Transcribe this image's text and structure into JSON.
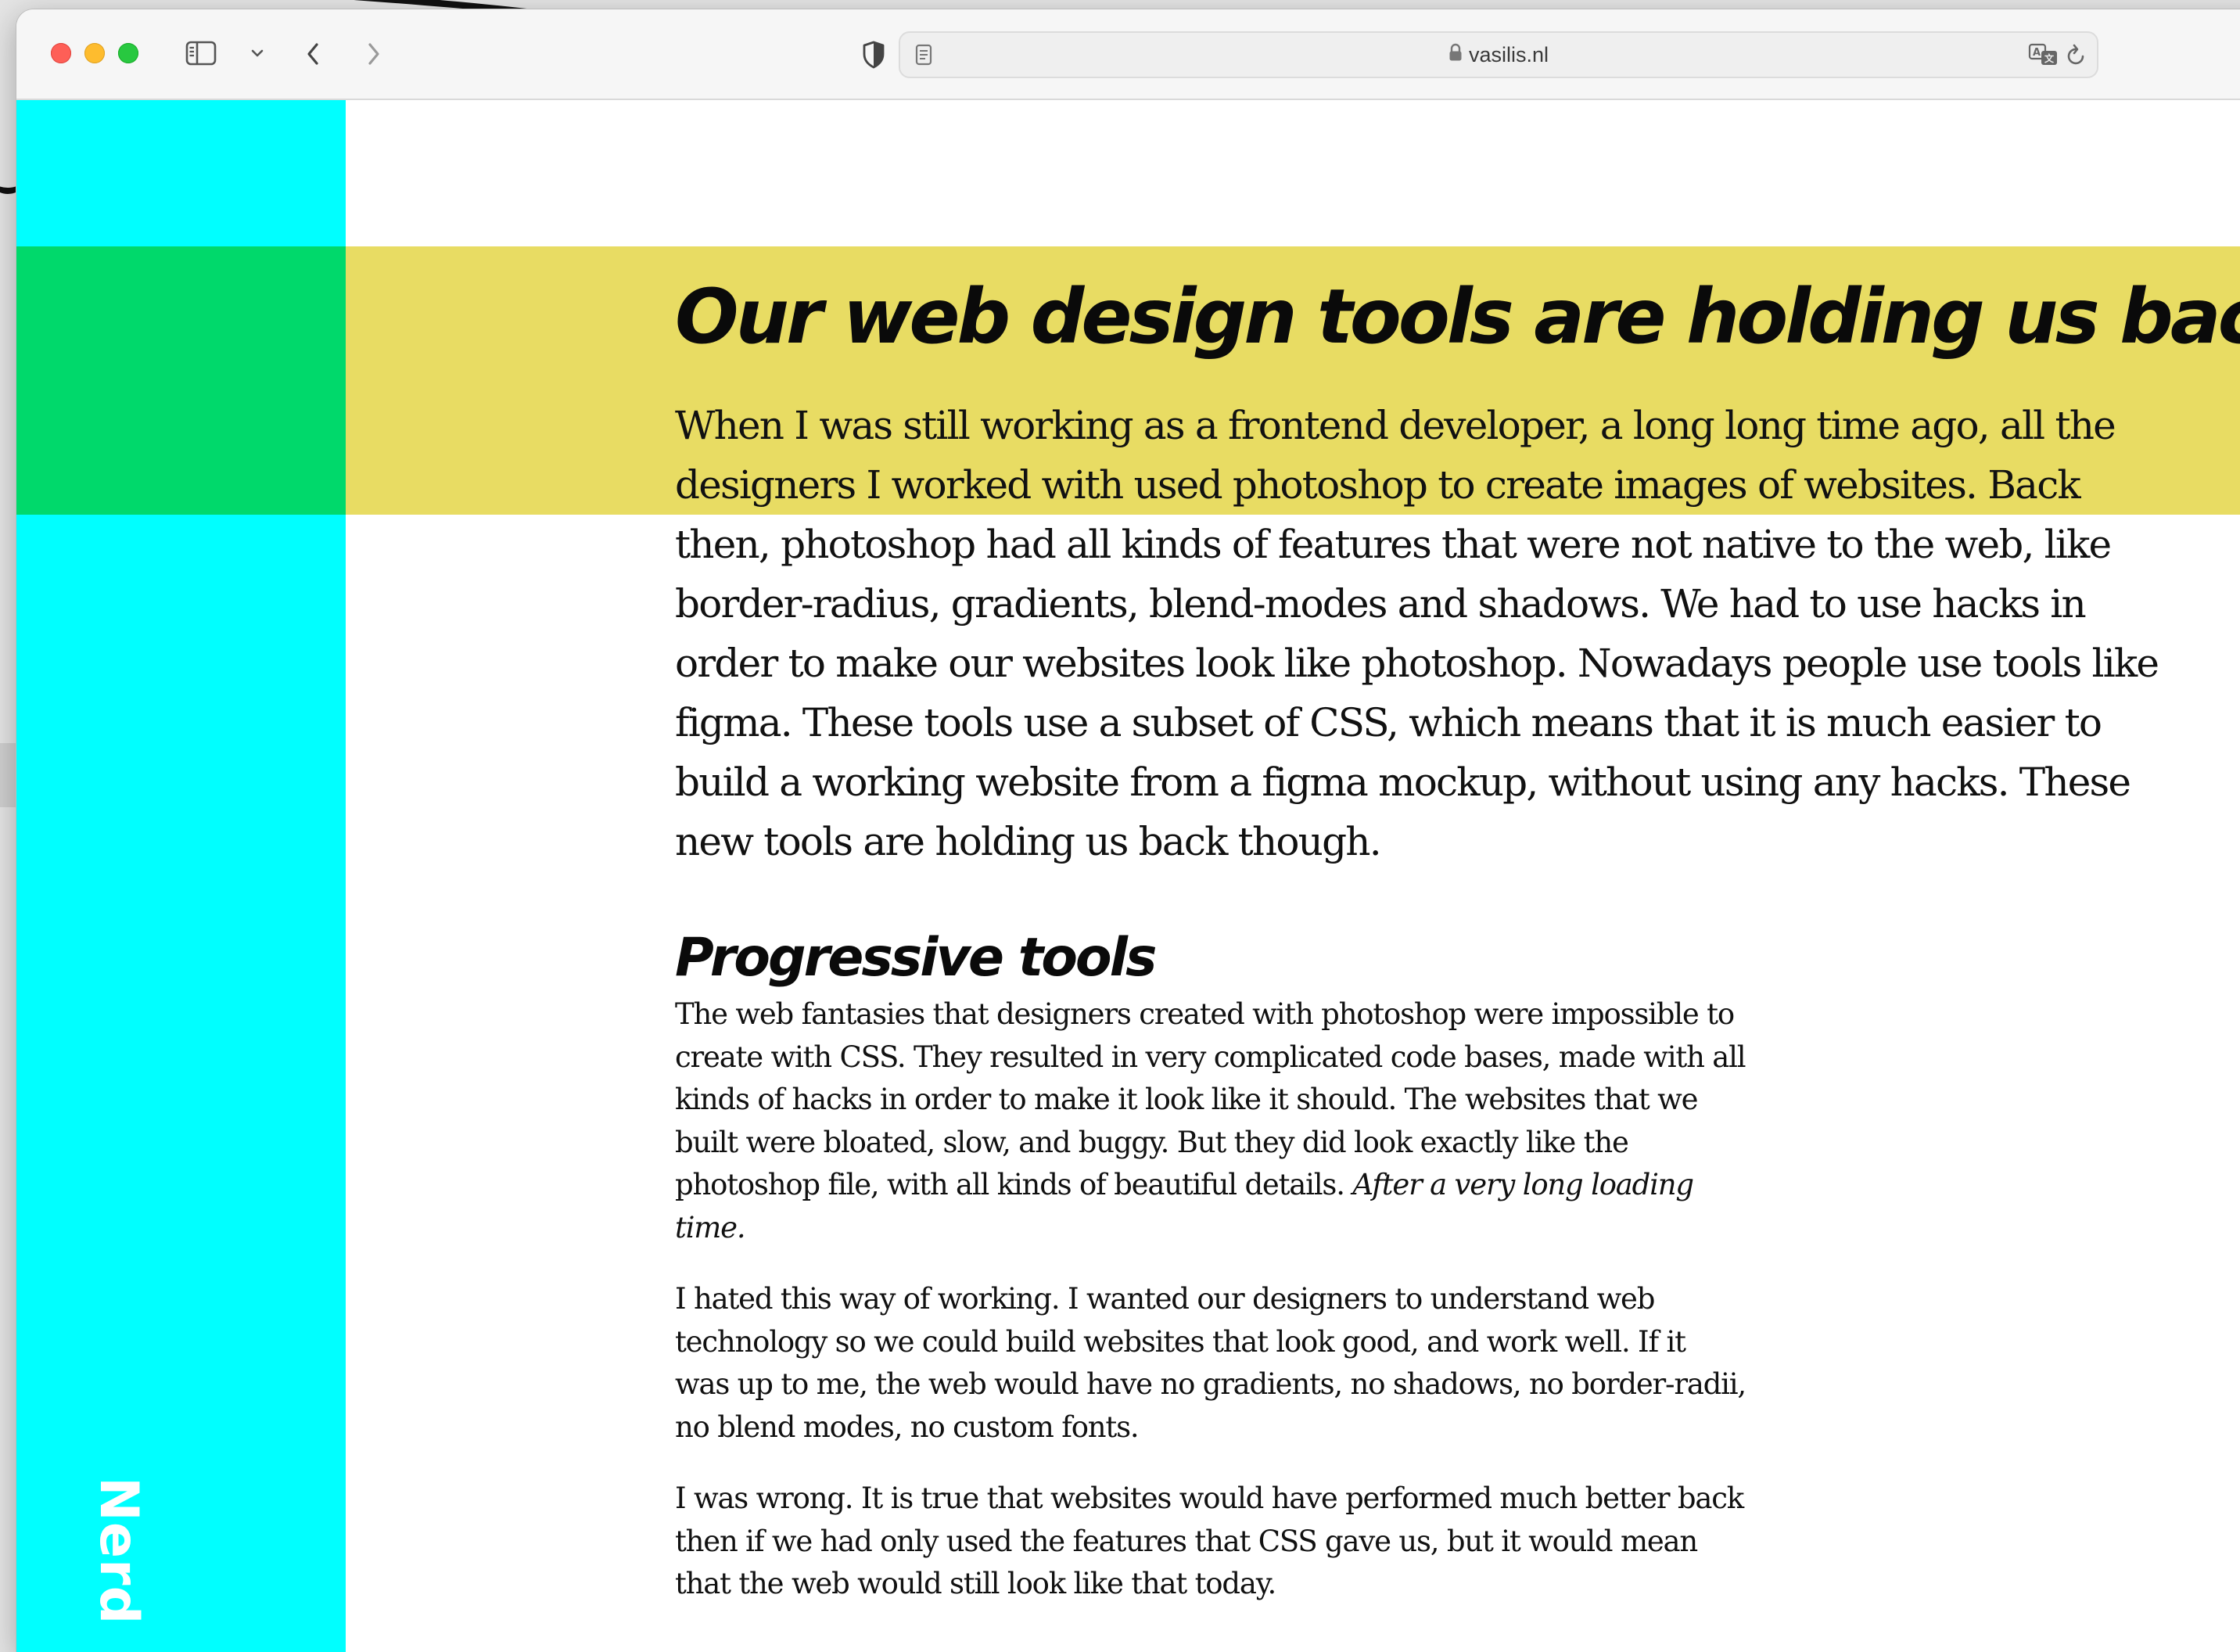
{
  "browser": {
    "url": "vasilis.nl",
    "icons": {
      "sidebar": "sidebar-icon",
      "sidebar_menu": "chevron-down-icon",
      "back": "chevron-left-icon",
      "forward": "chevron-right-icon",
      "privacy": "shield-icon",
      "reader": "reader-icon",
      "lock": "lock-icon",
      "translate": "translate-icon",
      "reload": "reload-icon"
    }
  },
  "colors": {
    "sidebar": "#00ffff",
    "accent_block": "#00d96b",
    "headline_band": "#e8dc63",
    "side_label": "#ffffff"
  },
  "page": {
    "side_label": "Nerd",
    "headline": "Our web design tools are holding us back",
    "intro": "When I was still working as a frontend developer, a long long time ago, all the designers I worked with used photoshop to create images of websites. Back then, photoshop had all kinds of features that were not native to the web, like border-radius, gradients, blend-modes and shadows. We had to use hacks in order to make our websites look like photoshop. Nowadays people use tools like figma. These tools use a subset of CSS, which means that it is much easier to build a working website from a figma mockup, without using any hacks. These new tools are holding us back though.",
    "section": {
      "heading": "Progressive tools",
      "p1_text": "The web fantasies that designers created with photoshop were impossible to create with CSS. They resulted in very complicated code bases, made with all kinds of hacks in order to make it look like it should. The websites that we built were bloated, slow, and buggy. But they did look exactly like the photoshop file, with all kinds of beautiful details.",
      "p1_italic": "After a very long loading time.",
      "p2": "I hated this way of working. I wanted our designers to understand web technology so we could build websites that look good, and work well. If it was up to me, the web would have no gradients, no shadows, no border-radii, no blend modes, no custom fonts.",
      "p3": "I was wrong. It is true that websites would have performed much better back then if we had only used the features that CSS gave us, but it would mean that the web would still look like that today."
    }
  }
}
